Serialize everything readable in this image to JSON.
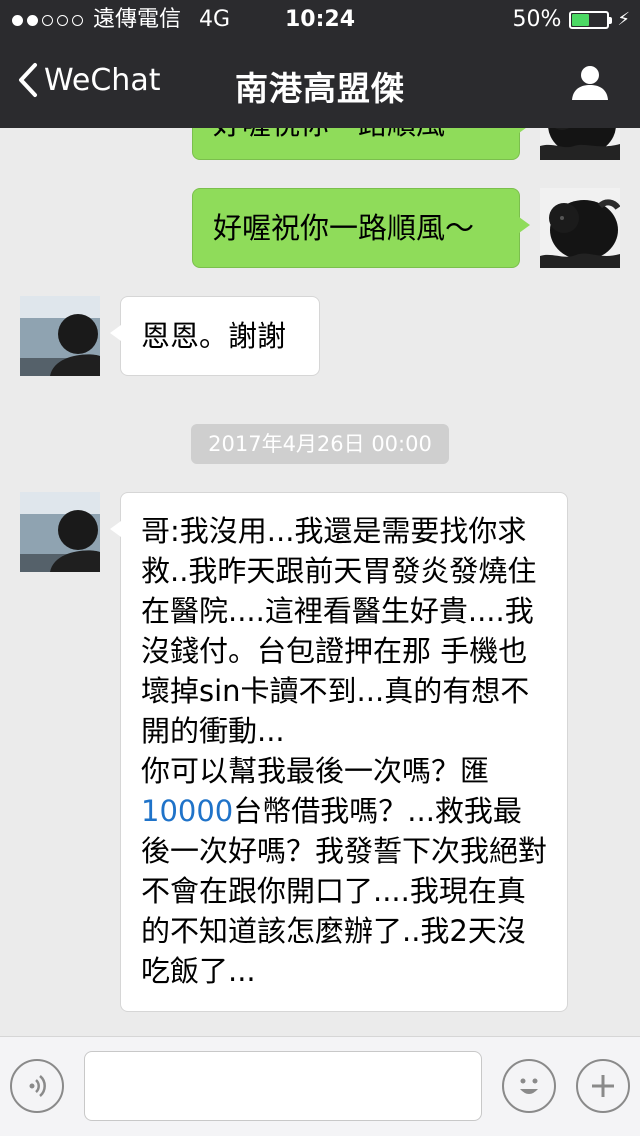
{
  "status_bar": {
    "carrier": "遠傳電信",
    "network": "4G",
    "time": "10:24",
    "battery_percent": "50%",
    "battery_level": 0.5,
    "battery_color": "#4cd964"
  },
  "nav": {
    "back_label": "WeChat",
    "title": "南港高盟傑",
    "profile_icon": "person-icon"
  },
  "messages": {
    "sent_partial": "好喔祝你一路順風～",
    "sent": "好喔祝你一路順風～",
    "reply": "恩恩。謝謝",
    "timestamp": "2017年4月26日 00:00",
    "long_part1": "哥:我沒用...我還是需要找你求救..我昨天跟前天胃發炎發燒住在醫院....這裡看醫生好貴....我沒錢付。台包證押在那 手機也壞掉sin卡讀不到...真的有想不開的衝動...\n你可以幫我最後一次嗎？匯",
    "long_link": "10000",
    "long_part2": "台幣借我嗎？...救我最後一次好嗎？我發誓下次我絕對不會在跟你開口了....我現在真的不知道該怎麼辦了..我2天沒吃飯了..."
  },
  "input_bar": {
    "voice_icon": "voice-icon",
    "emoji_icon": "emoji-icon",
    "plus_icon": "plus-icon",
    "input_value": ""
  },
  "colors": {
    "sent_bubble": "#8fdc5a",
    "received_bubble": "#ffffff",
    "link": "#1f73c9",
    "nav_bg": "#2b2b2e"
  }
}
